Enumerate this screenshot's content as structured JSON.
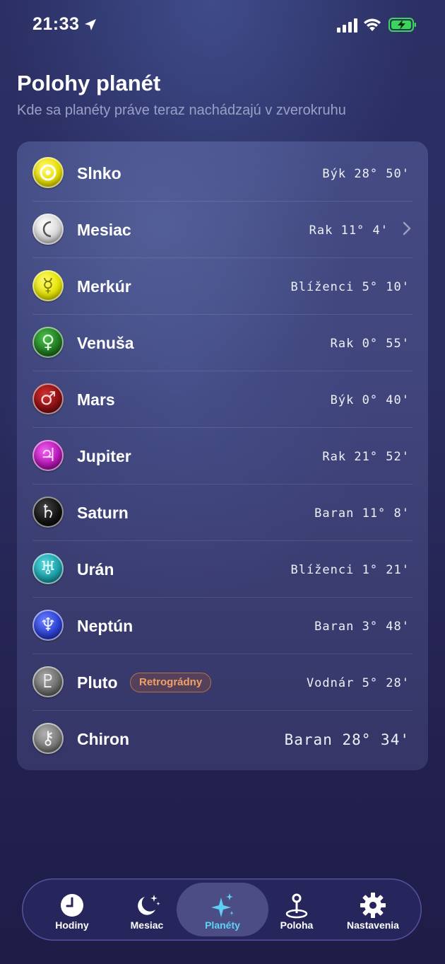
{
  "status_bar": {
    "time": "21:33"
  },
  "header": {
    "title": "Polohy planét",
    "subtitle": "Kde sa planéty práve teraz nachádzajú v zverokruhu"
  },
  "planets": [
    {
      "name": "Slnko",
      "position": "Býk 28° 50'",
      "symbol": "☉",
      "color": "#e8e000"
    },
    {
      "name": "Mesiac",
      "position": "Rak 11° 4'",
      "symbol": "☾",
      "color": "#d8d8d8"
    },
    {
      "name": "Merkúr",
      "position": "Blíženci 5° 10'",
      "symbol": "☿",
      "color": "#e6e600"
    },
    {
      "name": "Venuša",
      "position": "Rak 0° 55'",
      "symbol": "♀",
      "color": "#1f7a1f"
    },
    {
      "name": "Mars",
      "position": "Býk 0° 40'",
      "symbol": "♂",
      "color": "#8a0f12"
    },
    {
      "name": "Jupiter",
      "position": "Rak 21° 52'",
      "symbol": "♃",
      "color": "#b414b4"
    },
    {
      "name": "Saturn",
      "position": "Baran 11° 8'",
      "symbol": "♄",
      "color": "#111111"
    },
    {
      "name": "Urán",
      "position": "Blíženci 1° 21'",
      "symbol": "♅",
      "color": "#1aa0a8"
    },
    {
      "name": "Neptún",
      "position": "Baran 3° 48'",
      "symbol": "♆",
      "color": "#2a3fd0"
    },
    {
      "name": "Pluto",
      "position": "Vodnár 5° 28'",
      "symbol": "♇",
      "color": "#6a6a6a",
      "badge": "Retrográdny"
    },
    {
      "name": "Chiron",
      "position": "Baran 28° 34'",
      "symbol": "⚷",
      "color": "#7a7a7a"
    }
  ],
  "tabs": [
    {
      "label": "Hodiny",
      "icon": "clock-icon"
    },
    {
      "label": "Mesiac",
      "icon": "moon-stars-icon"
    },
    {
      "label": "Planéty",
      "icon": "sparkles-icon",
      "active": true
    },
    {
      "label": "Poloha",
      "icon": "map-pin-icon"
    },
    {
      "label": "Nastavenia",
      "icon": "gear-icon"
    }
  ],
  "colors": {
    "accent": "#5fd0f5",
    "badge": "#f0a068",
    "battery": "#3ad65a"
  }
}
